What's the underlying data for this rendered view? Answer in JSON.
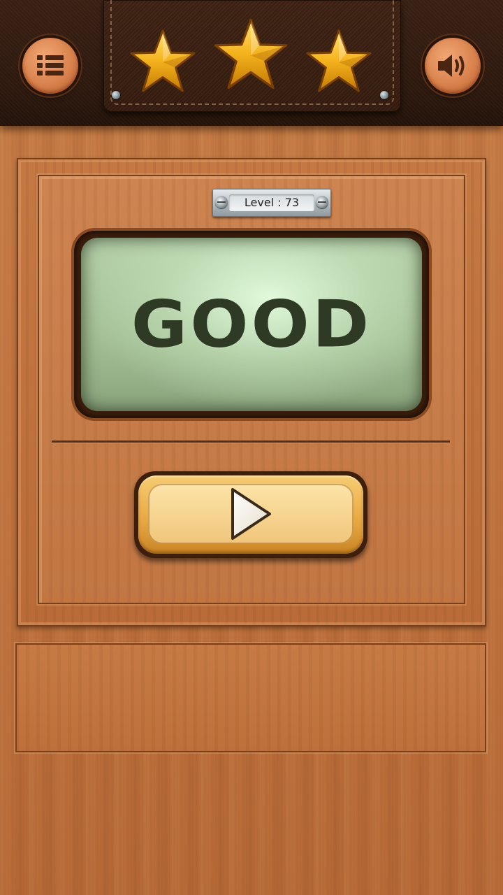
{
  "top_bar": {
    "menu_icon": "list-menu-icon",
    "sound_icon": "speaker-volume-icon",
    "stars_earned": 3,
    "stars_total": 3,
    "star_color": "#f4b21b"
  },
  "level": {
    "label": "Level : 73"
  },
  "screen": {
    "word": "GOOD",
    "text_color": "#2f3a25"
  },
  "play_button": {
    "icon": "play-icon"
  },
  "colors": {
    "wood": "#c27540",
    "leather": "#2e190e",
    "button_gold": "#e9aa45",
    "screen_green": "#a2bd94"
  }
}
